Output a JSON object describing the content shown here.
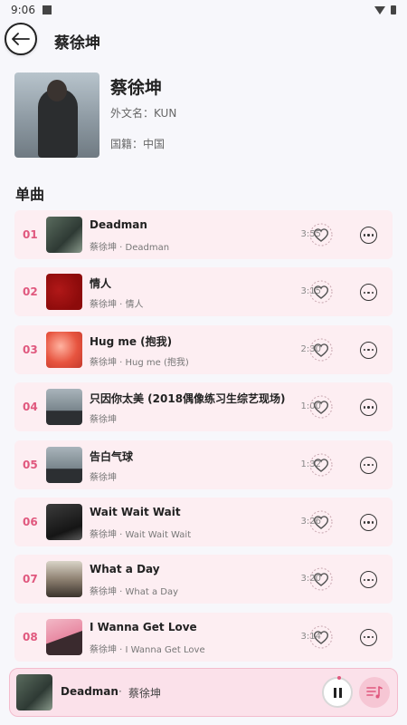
{
  "status_bar": {
    "time": "9:06"
  },
  "header": {
    "title": "蔡徐坤"
  },
  "artist": {
    "name": "蔡徐坤",
    "foreign_name": "外文名：KUN",
    "nationality": "国籍：中国"
  },
  "section": {
    "title": "单曲"
  },
  "songs": [
    {
      "index": "01",
      "title": "Deadman",
      "subtitle": "蔡徐坤 · Deadman",
      "duration": "3:55"
    },
    {
      "index": "02",
      "title": "情人",
      "subtitle": "蔡徐坤 · 情人",
      "duration": "3:15"
    },
    {
      "index": "03",
      "title": "Hug me (抱我)",
      "subtitle": "蔡徐坤 · Hug me (抱我)",
      "duration": "2:30"
    },
    {
      "index": "04",
      "title": "只因你太美 (2018偶像练习生综艺现场)",
      "subtitle": "蔡徐坤",
      "duration": "1:00"
    },
    {
      "index": "05",
      "title": "告白气球",
      "subtitle": "蔡徐坤",
      "duration": "1:32"
    },
    {
      "index": "06",
      "title": "Wait Wait Wait",
      "subtitle": "蔡徐坤 · Wait Wait Wait",
      "duration": "3:26"
    },
    {
      "index": "07",
      "title": "What a Day",
      "subtitle": "蔡徐坤 · What a Day",
      "duration": "3:20"
    },
    {
      "index": "08",
      "title": "I Wanna Get Love",
      "subtitle": "蔡徐坤 · I Wanna Get Love",
      "duration": "3:14"
    }
  ],
  "player": {
    "title": "Deadman",
    "separator": "·",
    "artist": "蔡徐坤"
  },
  "icons": {
    "back": "arrow-left-icon",
    "favorite": "heart-icon",
    "more": "more-horizontal-icon",
    "pause": "pause-icon",
    "playlist": "playlist-music-icon"
  },
  "colors": {
    "accent": "#e0587e",
    "row_bg": "#fdeef2",
    "player_bg": "#fbe1ea"
  }
}
